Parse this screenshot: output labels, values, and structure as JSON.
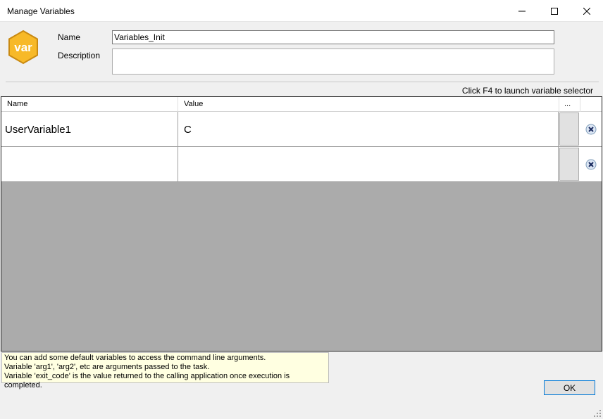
{
  "window": {
    "title": "Manage Variables",
    "controls": [
      "minimize-icon",
      "maximize-icon",
      "close-icon"
    ]
  },
  "logo": {
    "text": "var",
    "color": "#f7b928"
  },
  "form": {
    "name_label": "Name",
    "name_value": "Variables_Init",
    "description_label": "Description",
    "description_value": ""
  },
  "hint": "Click F4 to launch variable selector",
  "grid": {
    "columns": [
      "Name",
      "Value",
      "..."
    ],
    "rows": [
      {
        "name": "UserVariable1",
        "value": "C"
      },
      {
        "name": "",
        "value": ""
      }
    ]
  },
  "info": {
    "lines": [
      "You can add some default variables to access the command line arguments.",
      "Variable 'arg1', 'arg2', etc are arguments passed to the task.",
      "Variable 'exit_code' is the value returned to the calling application once execution is completed."
    ]
  },
  "ok_label": "OK"
}
